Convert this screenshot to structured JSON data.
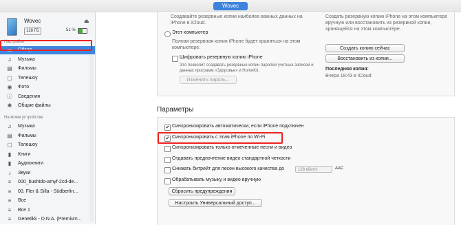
{
  "window": {
    "title": "Wovec"
  },
  "device": {
    "name": "Wovec",
    "capacity": "128 ГБ",
    "battery": "51 %",
    "battery_level": 0.51
  },
  "sidebar": {
    "settings_header": "Настройки",
    "settings_items": [
      {
        "label": "Обзор",
        "icon": "summary-icon",
        "selected": true
      },
      {
        "label": "Музыка",
        "icon": "music-icon"
      },
      {
        "label": "Фильмы",
        "icon": "film-icon"
      },
      {
        "label": "Телешоу",
        "icon": "tv-icon"
      },
      {
        "label": "Фото",
        "icon": "camera-icon"
      },
      {
        "label": "Сведения",
        "icon": "info-icon"
      },
      {
        "label": "Общие файлы",
        "icon": "apps-icon"
      }
    ],
    "device_header": "На моем устройстве",
    "device_items": [
      {
        "label": "Музыка",
        "icon": "music-icon"
      },
      {
        "label": "Фильмы",
        "icon": "film-icon"
      },
      {
        "label": "Телешоу",
        "icon": "tv-icon"
      },
      {
        "label": "Книги",
        "icon": "book-icon"
      },
      {
        "label": "Аудиокниги",
        "icon": "audiobook-icon"
      },
      {
        "label": "Звуки",
        "icon": "bell-icon"
      },
      {
        "label": "000_bushido-amyf-2cd-de...",
        "icon": "playlist-icon"
      },
      {
        "label": "00. Fler & Silla - Südberlin...",
        "icon": "playlist-icon"
      },
      {
        "label": "Все",
        "icon": "playlist-icon"
      },
      {
        "label": "Все 1",
        "icon": "playlist-icon"
      },
      {
        "label": "Genetikk - D.N.A. (Premium...",
        "icon": "playlist-icon"
      }
    ]
  },
  "backup": {
    "icloud_desc": "Создавайте резервные копии наиболее важных данных на iPhone в iCloud.",
    "this_computer": "Этот компьютер",
    "this_computer_desc": "Полная резервная копия iPhone будет храниться на этом компьютере.",
    "encrypt_label": "Шифровать резервную копию iPhone",
    "encrypt_desc": "Это позволит создавать резервные копии паролей учетных записей и данных программ «Здоровье» и HomeKit.",
    "change_password": "Изменить пароль...",
    "right_desc": "Создать резервную копию iPhone на этом компьютере вручную или восстановить из резервной копии, хранящейся на этом компьютере.",
    "backup_now": "Создать копию сейчас",
    "restore": "Восстановить из копии...",
    "last_backup_title": "Последняя копия:",
    "last_backup_value": "Вчера 18:43 в iCloud"
  },
  "params": {
    "title": "Параметры",
    "options": [
      {
        "label": "Синхронизировать автоматически, если iPhone подключен",
        "checked": true
      },
      {
        "label": "Синхронизировать с этим iPhone по Wi-Fi",
        "checked": true
      },
      {
        "label": "Синхронизировать только отмеченные песни и видео",
        "checked": false
      },
      {
        "label": "Отдавать предпочтение видео стандартной четкости",
        "checked": false
      },
      {
        "label": "Снижать битрейт для песен высокого качества до",
        "checked": false
      },
      {
        "label": "Обрабатывать музыку и видео вручную",
        "checked": false
      }
    ],
    "bitrate_value": "128 кбит/с",
    "bitrate_unit": "AAC",
    "reset_warnings": "Сбросить предупреждения",
    "accessibility": "Настроить Универсальный доступ..."
  }
}
